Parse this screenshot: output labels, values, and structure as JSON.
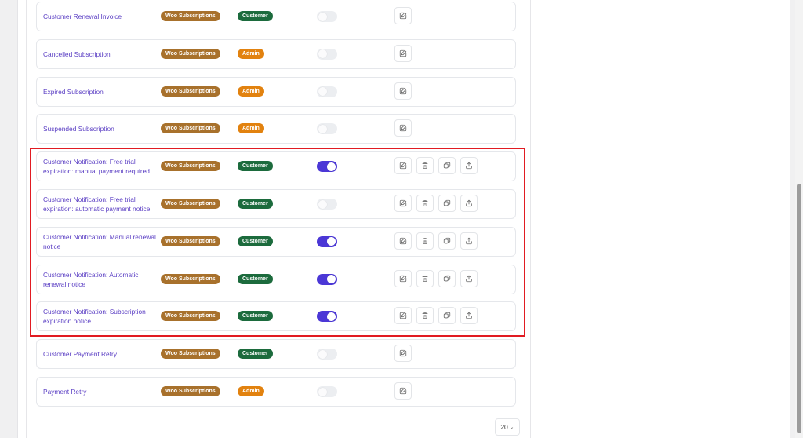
{
  "emails": [
    {
      "name": "Customer Renewal Invoice",
      "source": "Woo Subscriptions",
      "recipient": "Customer",
      "recipient_type": "customer",
      "enabled": false,
      "actions": [
        "edit"
      ]
    },
    {
      "name": "Cancelled Subscription",
      "source": "Woo Subscriptions",
      "recipient": "Admin",
      "recipient_type": "admin",
      "enabled": false,
      "actions": [
        "edit"
      ]
    },
    {
      "name": "Expired Subscription",
      "source": "Woo Subscriptions",
      "recipient": "Admin",
      "recipient_type": "admin",
      "enabled": false,
      "actions": [
        "edit"
      ]
    },
    {
      "name": "Suspended Subscription",
      "source": "Woo Subscriptions",
      "recipient": "Admin",
      "recipient_type": "admin",
      "enabled": false,
      "actions": [
        "edit"
      ]
    },
    {
      "name": "Customer Notification: Free trial expiration: manual payment required",
      "source": "Woo Subscriptions",
      "recipient": "Customer",
      "recipient_type": "customer",
      "enabled": true,
      "actions": [
        "edit",
        "delete",
        "duplicate",
        "export"
      ]
    },
    {
      "name": "Customer Notification: Free trial expiration: automatic payment notice",
      "source": "Woo Subscriptions",
      "recipient": "Customer",
      "recipient_type": "customer",
      "enabled": false,
      "actions": [
        "edit",
        "delete",
        "duplicate",
        "export"
      ]
    },
    {
      "name": "Customer Notification: Manual renewal notice",
      "source": "Woo Subscriptions",
      "recipient": "Customer",
      "recipient_type": "customer",
      "enabled": true,
      "actions": [
        "edit",
        "delete",
        "duplicate",
        "export"
      ]
    },
    {
      "name": "Customer Notification: Automatic renewal notice",
      "source": "Woo Subscriptions",
      "recipient": "Customer",
      "recipient_type": "customer",
      "enabled": true,
      "actions": [
        "edit",
        "delete",
        "duplicate",
        "export"
      ]
    },
    {
      "name": "Customer Notification: Subscription expiration notice",
      "source": "Woo Subscriptions",
      "recipient": "Customer",
      "recipient_type": "customer",
      "enabled": true,
      "actions": [
        "edit",
        "delete",
        "duplicate",
        "export"
      ]
    },
    {
      "name": "Customer Payment Retry",
      "source": "Woo Subscriptions",
      "recipient": "Customer",
      "recipient_type": "customer",
      "enabled": false,
      "actions": [
        "edit"
      ]
    },
    {
      "name": "Payment Retry",
      "source": "Woo Subscriptions",
      "recipient": "Admin",
      "recipient_type": "admin",
      "enabled": false,
      "actions": [
        "edit"
      ]
    }
  ],
  "pagination": {
    "per_page": "20"
  },
  "colors": {
    "link": "#5b3fc4",
    "source_badge": "#a8712c",
    "customer_badge": "#1c6b3d",
    "admin_badge": "#e2820f",
    "toggle_on": "#4b37d6",
    "highlight": "#e11b22"
  },
  "icons": {
    "edit": "edit-icon",
    "delete": "trash-icon",
    "duplicate": "duplicate-icon",
    "export": "export-icon",
    "chevron": "chevron-down-icon"
  }
}
